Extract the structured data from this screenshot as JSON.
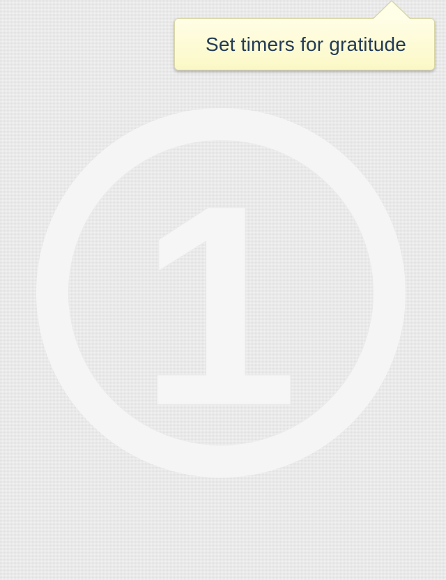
{
  "tooltip": {
    "text": "Set timers for gratitude"
  },
  "step_badge": {
    "number": "1"
  },
  "colors": {
    "tooltip_background": "#fcf9c9",
    "tooltip_text": "#223a55",
    "badge_fill": "#f6f6f6",
    "page_background": "#e9e9e9"
  }
}
